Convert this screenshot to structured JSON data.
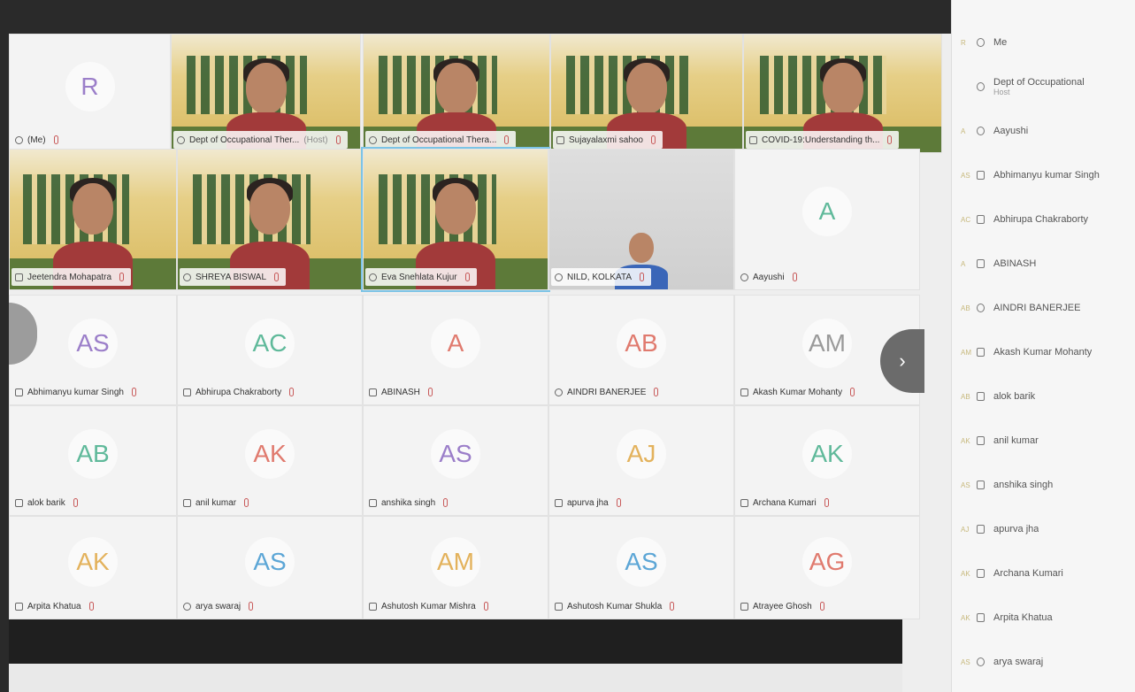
{
  "video_tiles": [
    {
      "name": "(Me)",
      "avatar": "R",
      "avatar_color": "#9b7ec9",
      "video": false,
      "device": "web"
    },
    {
      "name": "Dept of Occupational Ther...",
      "badge": "(Host)",
      "video": true,
      "device": "web"
    },
    {
      "name": "Dept of Occupational Thera...",
      "video": true,
      "device": "web"
    },
    {
      "name": "Sujayalaxmi sahoo",
      "video": true,
      "device": "phone"
    },
    {
      "name": "COVID-19:Understanding th...",
      "video": true,
      "device": "phone"
    },
    {
      "name": "Jeetendra Mohapatra",
      "video": true,
      "device": "phone"
    },
    {
      "name": "SHREYA BISWAL",
      "video": true,
      "device": "web"
    },
    {
      "name": "Eva Snehlata Kujur",
      "video": true,
      "device": "web",
      "selected": true
    },
    {
      "name": "NILD, KOLKATA",
      "video": true,
      "device": "web",
      "gray": true
    },
    {
      "name": "Aayushi",
      "avatar": "A",
      "avatar_color": "#5fb99a",
      "video": false,
      "device": "web"
    }
  ],
  "avatar_tiles": [
    {
      "name": "Abhimanyu kumar Singh",
      "avatar": "AS",
      "avatar_color": "#9b7ec9",
      "device": "phone"
    },
    {
      "name": "Abhirupa Chakraborty",
      "avatar": "AC",
      "avatar_color": "#5fb99a",
      "device": "phone"
    },
    {
      "name": "ABINASH",
      "avatar": "A",
      "avatar_color": "#e07a6e",
      "device": "phone"
    },
    {
      "name": "AINDRI BANERJEE",
      "avatar": "AB",
      "avatar_color": "#e07a6e",
      "device": "web"
    },
    {
      "name": "Akash Kumar Mohanty",
      "avatar": "AM",
      "avatar_color": "#9a9a9a",
      "device": "phone"
    },
    {
      "name": "alok barik",
      "avatar": "AB",
      "avatar_color": "#5fb99a",
      "device": "phone"
    },
    {
      "name": "anil kumar",
      "avatar": "AK",
      "avatar_color": "#e07a6e",
      "device": "phone"
    },
    {
      "name": "anshika singh",
      "avatar": "AS",
      "avatar_color": "#9b7ec9",
      "device": "phone"
    },
    {
      "name": "apurva jha",
      "avatar": "AJ",
      "avatar_color": "#e3b25c",
      "device": "phone"
    },
    {
      "name": "Archana Kumari",
      "avatar": "AK",
      "avatar_color": "#5fb99a",
      "device": "phone"
    },
    {
      "name": "Arpita Khatua",
      "avatar": "AK",
      "avatar_color": "#e3b25c",
      "device": "phone"
    },
    {
      "name": "arya swaraj",
      "avatar": "AS",
      "avatar_color": "#5ca6d6",
      "device": "web"
    },
    {
      "name": "Ashutosh Kumar Mishra",
      "avatar": "AM",
      "avatar_color": "#e3b25c",
      "device": "phone"
    },
    {
      "name": "Ashutosh Kumar Shukla",
      "avatar": "AS",
      "avatar_color": "#5ca6d6",
      "device": "phone"
    },
    {
      "name": "Atrayee Ghosh",
      "avatar": "AG",
      "avatar_color": "#e07a6e",
      "device": "phone"
    }
  ],
  "panel": {
    "items": [
      {
        "name": "Me",
        "sub": "",
        "avatar": "R",
        "device": "web"
      },
      {
        "name": "Dept of Occupational",
        "sub": "Host",
        "avatar": "",
        "device": "web"
      },
      {
        "name": "Aayushi",
        "sub": "",
        "avatar": "A",
        "device": "web"
      },
      {
        "name": "Abhimanyu kumar Singh",
        "sub": "",
        "avatar": "AS",
        "device": "phone"
      },
      {
        "name": "Abhirupa Chakraborty",
        "sub": "",
        "avatar": "AC",
        "device": "phone"
      },
      {
        "name": "ABINASH",
        "sub": "",
        "avatar": "A",
        "device": "phone"
      },
      {
        "name": "AINDRI BANERJEE",
        "sub": "",
        "avatar": "AB",
        "device": "web"
      },
      {
        "name": "Akash Kumar Mohanty",
        "sub": "",
        "avatar": "AM",
        "device": "phone"
      },
      {
        "name": "alok barik",
        "sub": "",
        "avatar": "AB",
        "device": "phone"
      },
      {
        "name": "anil kumar",
        "sub": "",
        "avatar": "AK",
        "device": "phone"
      },
      {
        "name": "anshika singh",
        "sub": "",
        "avatar": "AS",
        "device": "phone"
      },
      {
        "name": "apurva jha",
        "sub": "",
        "avatar": "AJ",
        "device": "phone"
      },
      {
        "name": "Archana Kumari",
        "sub": "",
        "avatar": "AK",
        "device": "phone"
      },
      {
        "name": "Arpita Khatua",
        "sub": "",
        "avatar": "AK",
        "device": "phone"
      },
      {
        "name": "arya swaraj",
        "sub": "",
        "avatar": "AS",
        "device": "web"
      }
    ]
  },
  "icons": {
    "next": "chevron-right-icon",
    "mic": "mic-muted-icon",
    "phone": "phone-icon",
    "web": "web-icon"
  }
}
